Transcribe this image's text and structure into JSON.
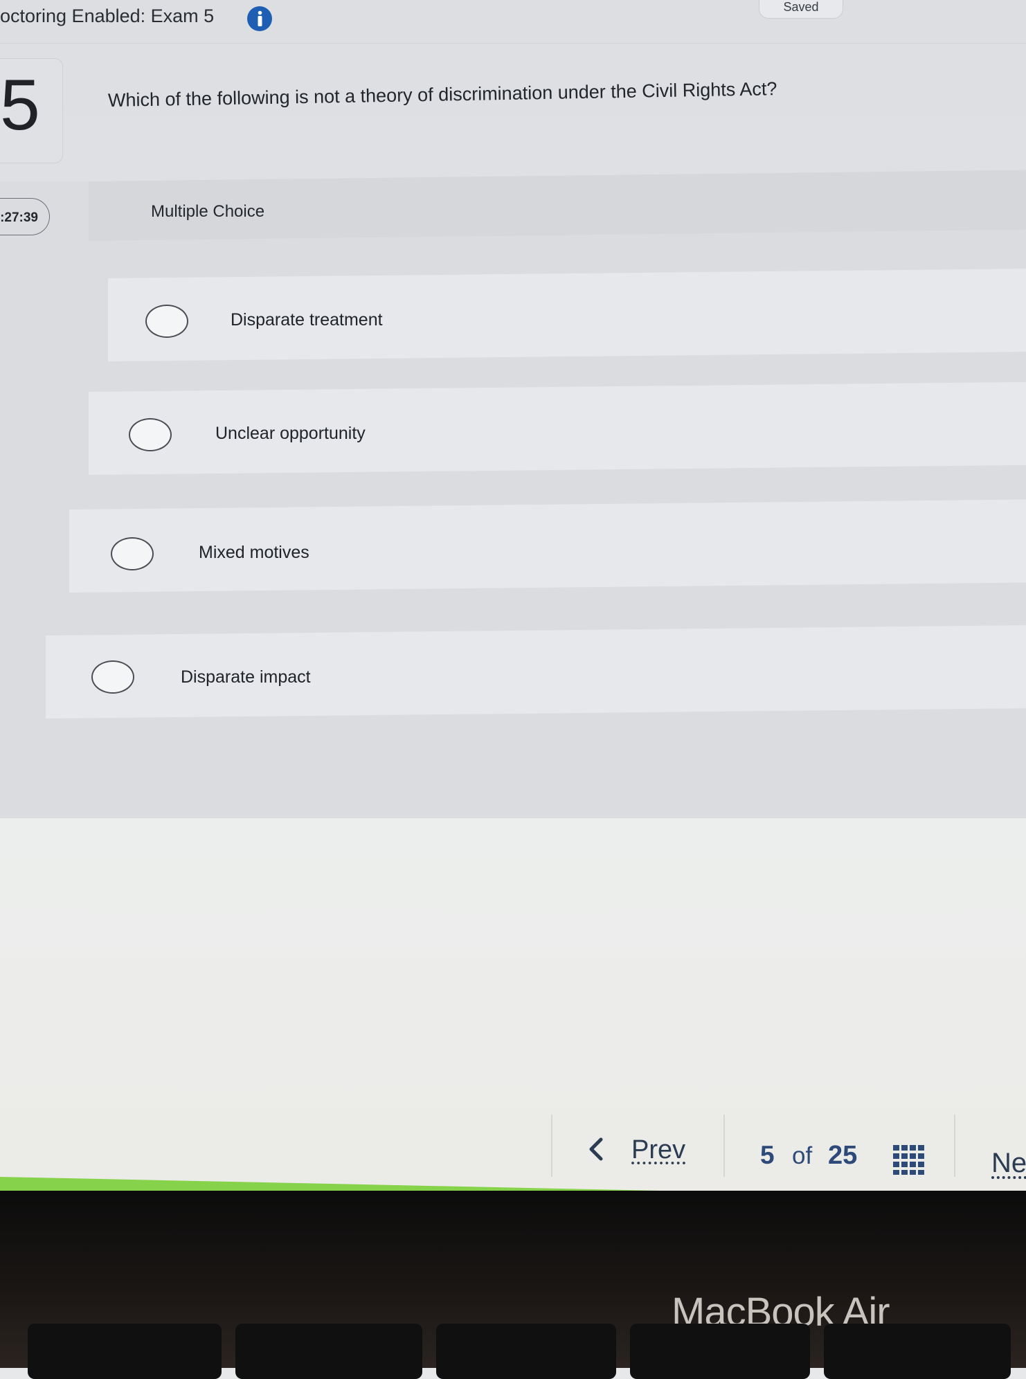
{
  "header": {
    "exam_title": "octoring Enabled: Exam 5",
    "info_icon": "info-icon",
    "saved_status": "Saved"
  },
  "question": {
    "number": "5",
    "text": "Which of the following is not a theory of discrimination under the Civil Rights Act?",
    "timer": ":27:39",
    "type_label": "Multiple Choice"
  },
  "options": [
    {
      "label": "Disparate treatment",
      "selected": false
    },
    {
      "label": "Unclear opportunity",
      "selected": false
    },
    {
      "label": "Mixed motives",
      "selected": false
    },
    {
      "label": "Disparate impact",
      "selected": false
    }
  ],
  "navigation": {
    "prev_label": "Prev",
    "current_page": "5",
    "of_label": "of",
    "total_pages": "25",
    "next_label": "Ne",
    "grid_icon": "grid-icon",
    "chevron_icon": "chevron-left-icon"
  },
  "device": {
    "brand_label": "MacBook Air"
  },
  "colors": {
    "progress_bar": "#86d24a",
    "nav_text": "#2e4a78",
    "info_icon": "#1e5fb4"
  }
}
